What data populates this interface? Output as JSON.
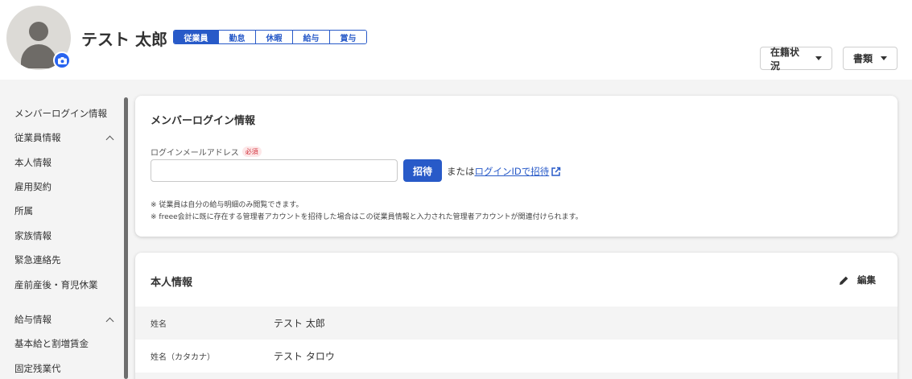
{
  "profile": {
    "name": "テスト 太郎",
    "tabs": [
      "従業員",
      "勤怠",
      "休暇",
      "給与",
      "賞与"
    ]
  },
  "header_actions": {
    "status_label": "在籍状況",
    "documents_label": "書類"
  },
  "sidebar": {
    "login_info": "メンバーログイン情報",
    "employee_group": "従業員情報",
    "employee_items": [
      "本人情報",
      "雇用契約",
      "所属",
      "家族情報",
      "緊急連絡先",
      "産前産後・育児休業"
    ],
    "salary_group": "給与情報",
    "salary_items": [
      "基本給と割増賃金",
      "固定残業代"
    ]
  },
  "login_card": {
    "title": "メンバーログイン情報",
    "email_label": "ログインメールアドレス",
    "required_badge": "必須",
    "email_value": "",
    "invite_button": "招待",
    "or_text": "または",
    "login_id_link": "ログインIDで招待",
    "note1": "※ 従業員は自分の給与明細のみ閲覧できます。",
    "note2": "※ freee会計に既に存在する管理者アカウントを招待した場合はこの従業員情報と入力された管理者アカウントが関連付けられます。"
  },
  "personal_card": {
    "title": "本人情報",
    "edit_label": "編集",
    "rows": [
      {
        "label": "姓名",
        "value": "テスト 太郎"
      },
      {
        "label": "姓名（カタカナ）",
        "value": "テスト タロウ"
      }
    ]
  },
  "colors": {
    "accent": "#285ac8",
    "avatar_bg": "#dcdad6",
    "camera": "#2864f0",
    "required": "#d2323c"
  },
  "icons": [
    "person-icon",
    "camera-icon",
    "caret-down-icon",
    "chevron-up-icon",
    "external-link-icon",
    "pencil-icon"
  ]
}
